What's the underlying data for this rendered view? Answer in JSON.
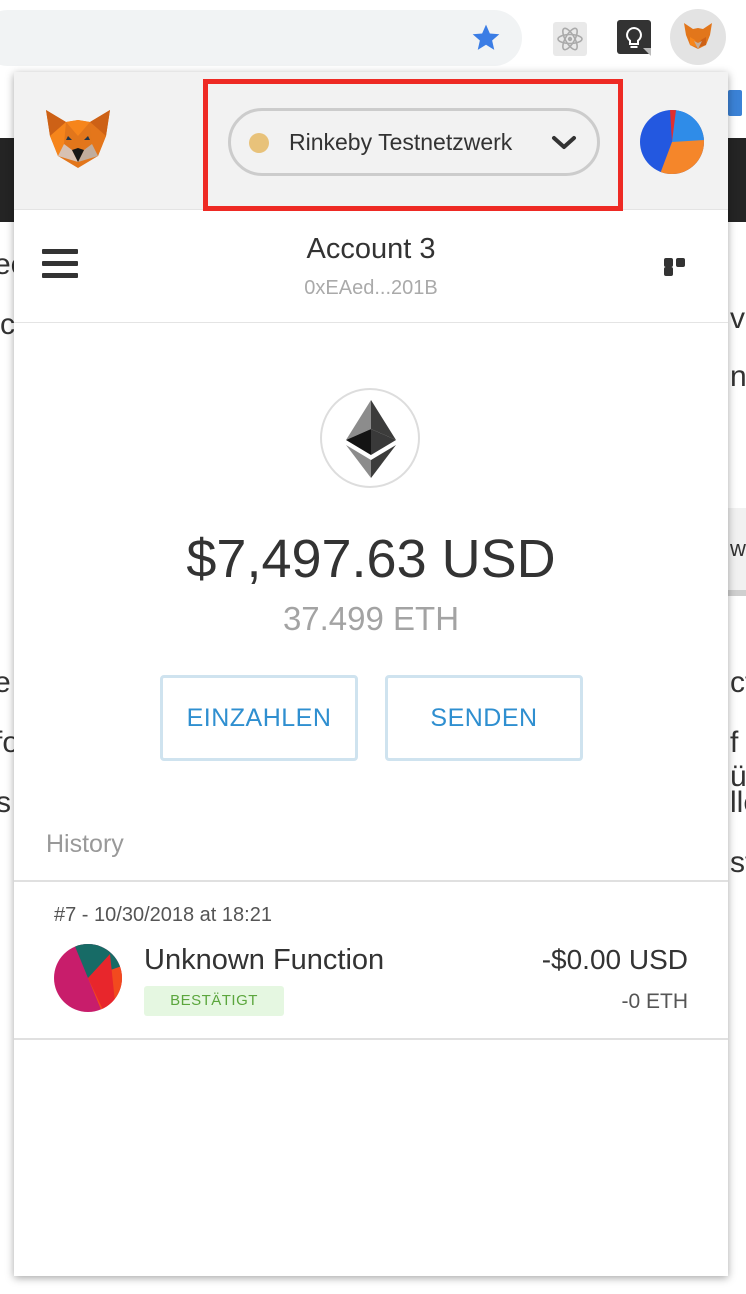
{
  "browser": {
    "icons": [
      "bookmark-star-icon",
      "react-devtools-icon",
      "lightbulb-extension-icon",
      "metamask-extension-icon"
    ],
    "star_color": "#3b7de5"
  },
  "background_text": {
    "left_fragments": [
      "ee",
      "c",
      "e",
      "fo",
      "s"
    ],
    "right_fragments": [
      "v",
      "n",
      "w",
      "ct",
      "f ü",
      "lle",
      "st"
    ]
  },
  "header": {
    "network": {
      "name": "Rinkeby Testnetzwerk",
      "dot_color": "#e8c27a"
    },
    "highlight_color": "#ee2a24"
  },
  "account": {
    "name": "Account 3",
    "address": "0xEAed...201B"
  },
  "balance": {
    "fiat": "$7,497.63 USD",
    "crypto": "37.499 ETH"
  },
  "actions": {
    "deposit_label": "EINZAHLEN",
    "send_label": "SENDEN"
  },
  "history": {
    "label": "History",
    "transactions": [
      {
        "meta": "#7 - 10/30/2018 at 18:21",
        "title": "Unknown Function",
        "status": "BESTÄTIGT",
        "fiat": "-$0.00 USD",
        "eth": "-0 ETH"
      }
    ]
  },
  "colors": {
    "accent_blue": "#2f8fd0",
    "status_green": "#5ba63d"
  }
}
